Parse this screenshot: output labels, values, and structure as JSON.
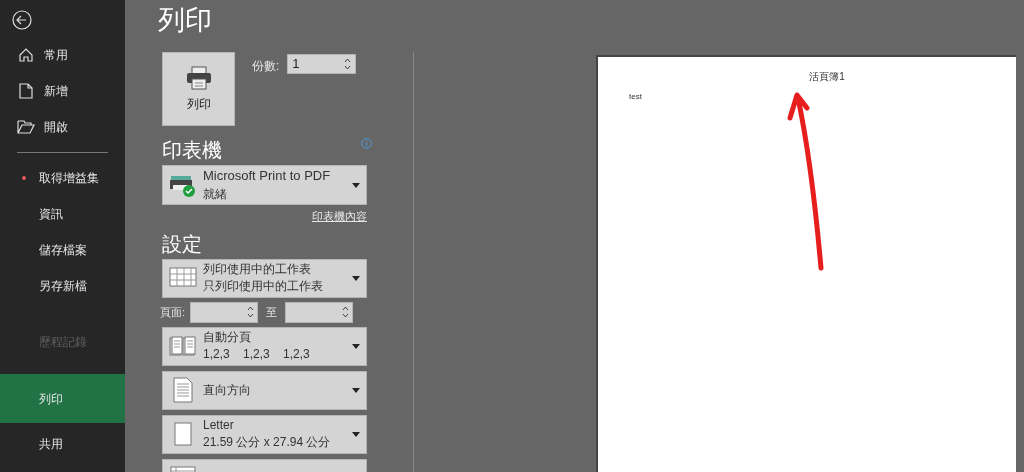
{
  "sidebar": {
    "top_items": [
      {
        "label": "常用"
      },
      {
        "label": "新增"
      },
      {
        "label": "開啟"
      }
    ],
    "items": [
      {
        "label": "取得增益集",
        "selected": false,
        "disabled": false,
        "color": "#e05a5a"
      },
      {
        "label": "資訊",
        "selected": false,
        "disabled": false
      },
      {
        "label": "儲存檔案",
        "selected": false,
        "disabled": false
      },
      {
        "label": "另存新檔",
        "selected": false,
        "disabled": false
      },
      {
        "label": "歷程記錄",
        "selected": false,
        "disabled": true
      },
      {
        "label": "列印",
        "selected": true,
        "disabled": false
      },
      {
        "label": "共用",
        "selected": false,
        "disabled": false
      }
    ]
  },
  "title": "列印",
  "print_button": {
    "label": "列印"
  },
  "copies": {
    "label": "份數:",
    "value": "1"
  },
  "printer": {
    "heading": "印表機",
    "name": "Microsoft Print to PDF",
    "status": "就緒",
    "properties_link": "印表機內容"
  },
  "settings": {
    "heading": "設定",
    "options": [
      {
        "kind": "sheets",
        "title": "列印使用中的工作表",
        "subtitle": "只列印使用中的工作表"
      },
      {
        "kind": "pages",
        "label": "頁面:",
        "to_label": "至"
      },
      {
        "kind": "collate",
        "title": "自動分頁",
        "subtitle": "1,2,3    1,2,3    1,2,3"
      },
      {
        "kind": "orientation",
        "title": "直向方向"
      },
      {
        "kind": "paper",
        "title": "Letter",
        "subtitle": "21.59 公分 x 27.94 公分"
      },
      {
        "kind": "margins"
      }
    ]
  },
  "preview": {
    "header": "活頁簿1",
    "cell": "test"
  }
}
